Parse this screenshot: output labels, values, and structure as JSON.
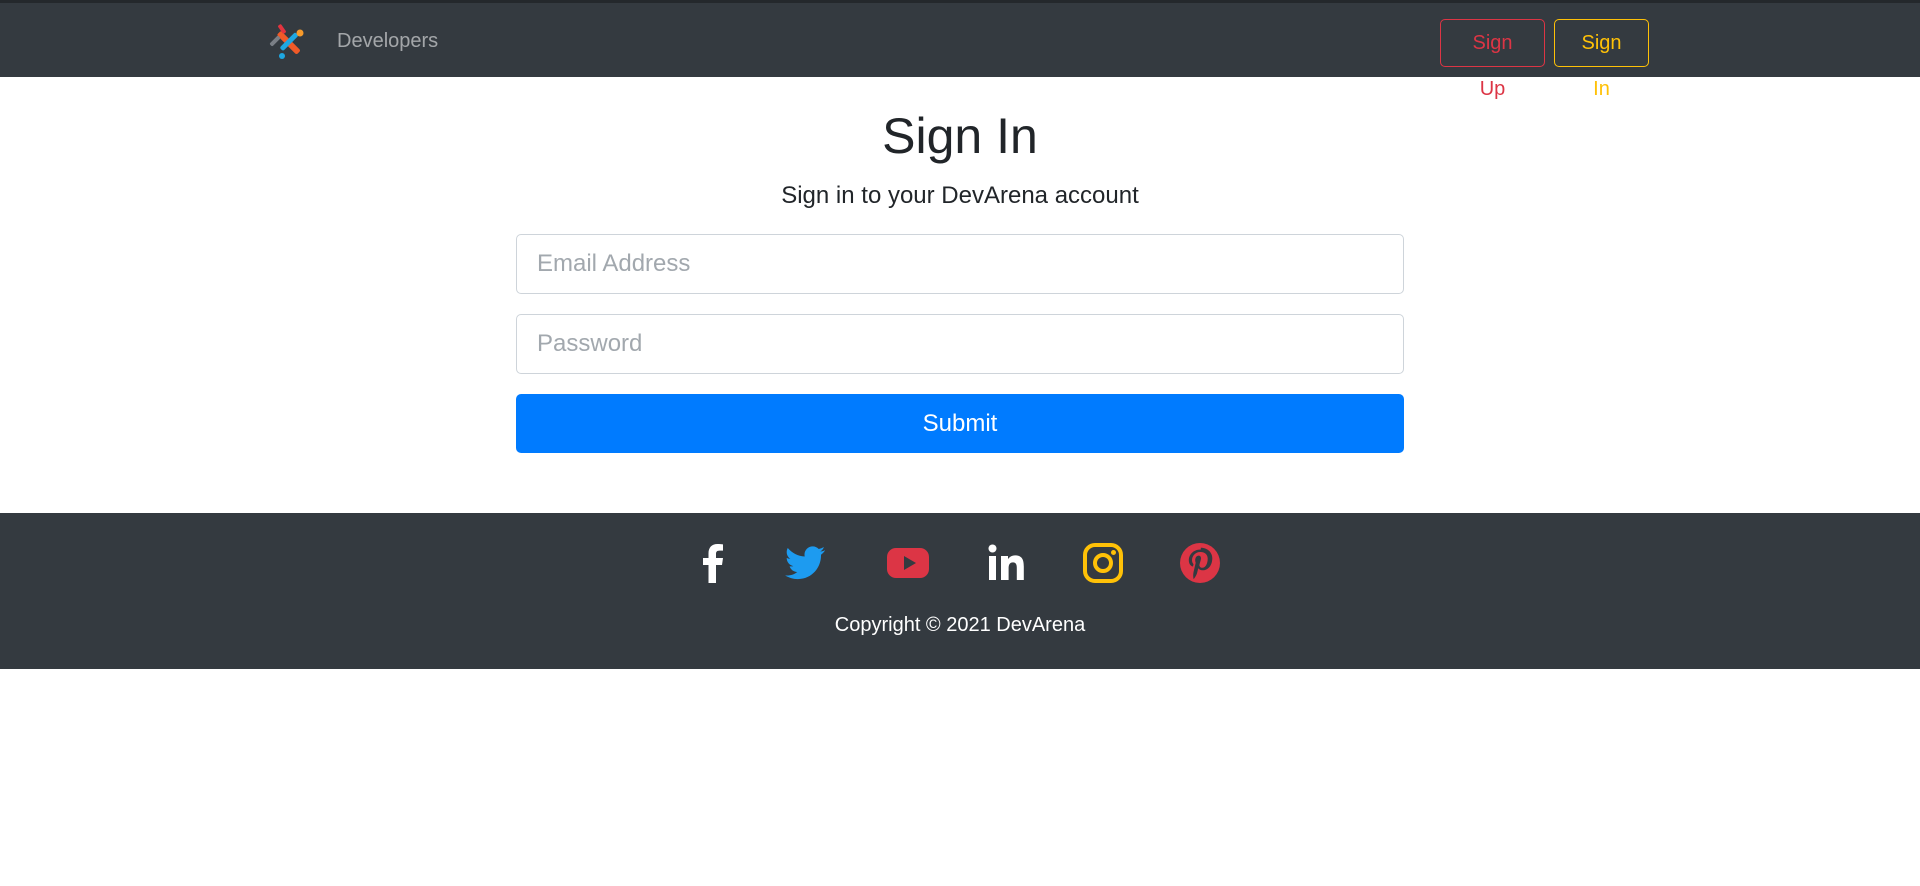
{
  "navbar": {
    "brand_logo_icon": "crossed-tools-logo-icon",
    "nav_link": "Developers",
    "signup_label": "Sign Up",
    "signin_label": "Sign In"
  },
  "main": {
    "title": "Sign In",
    "subtitle": "Sign in to your DevArena account",
    "email_placeholder": "Email Address",
    "email_value": "",
    "password_placeholder": "Password",
    "password_value": "",
    "submit_label": "Submit"
  },
  "footer": {
    "social_icons": [
      "facebook-icon",
      "twitter-icon",
      "youtube-icon",
      "linkedin-icon",
      "instagram-icon",
      "pinterest-icon"
    ],
    "copyright": "Copyright © 2021 DevArena"
  },
  "colors": {
    "navbar_bg": "#343a40",
    "signup_accent": "#dc3545",
    "signin_accent": "#ffc107",
    "primary": "#007bff",
    "twitter": "#1d9bf0",
    "youtube": "#dc3545",
    "instagram": "#ffc107",
    "pinterest": "#dc3545"
  }
}
